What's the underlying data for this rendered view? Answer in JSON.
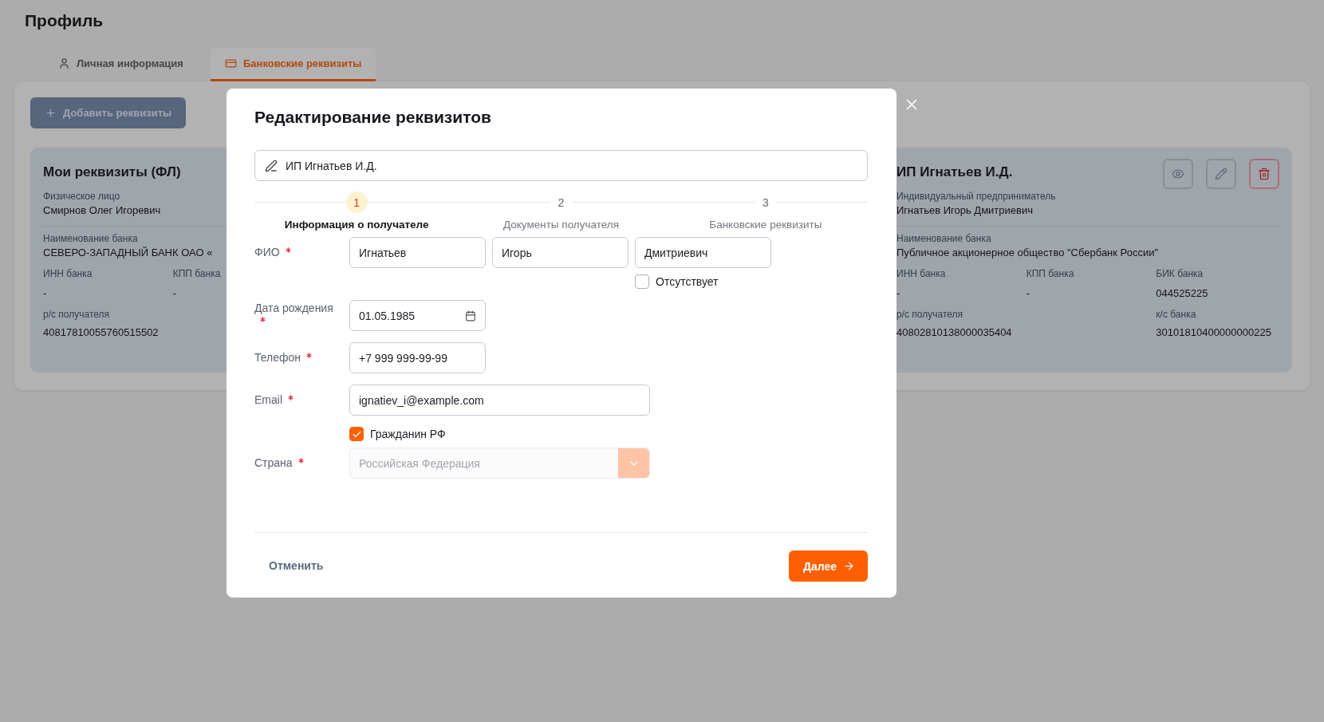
{
  "page": {
    "title": "Профиль"
  },
  "tabs": [
    {
      "label": "Личная информация",
      "selected": false
    },
    {
      "label": "Банковские реквизиты",
      "selected": true
    }
  ],
  "add_button": {
    "label": "Добавить реквизиты"
  },
  "cards": [
    {
      "kind": "partial",
      "title": "Мои реквизиты (ФЛ)",
      "type_label": "Физическое лицо",
      "holder": "Смирнов Олег Игоревич",
      "bank_label": "Наименование банка",
      "bank_name": "СЕВЕРО-ЗАПАДНЫЙ БАНК ОАО «",
      "row1": [
        {
          "label": "ИНН банка",
          "value": "-"
        },
        {
          "label": "КПП банка",
          "value": "-"
        }
      ],
      "row2": [
        {
          "label": "р/с получателя",
          "value": "40817810055760515502"
        }
      ]
    },
    {
      "kind": "full",
      "title": "ИП Игнатьев И.Д.",
      "type_label": "Индивидуальный предприниматель",
      "holder": "Игнатьев Игорь Дмитриевич",
      "bank_label": "Наименование банка",
      "bank_name": "Публичное акционерное общество \"Сбербанк России\"",
      "row1": [
        {
          "label": "ИНН банка",
          "value": "-"
        },
        {
          "label": "КПП банка",
          "value": "-"
        },
        {
          "label": "БИК банка",
          "value": "044525225"
        }
      ],
      "row2": [
        {
          "label": "р/с получателя",
          "value": "40802810138000035404"
        },
        {
          "label": "к/с банка",
          "value": "30101810400000000225"
        }
      ]
    }
  ],
  "dialog": {
    "title": "Редактирование реквизитов",
    "name_field": {
      "value": "ИП Игнатьев И.Д."
    },
    "steps": [
      {
        "number": "1",
        "label": "Информация о получателе",
        "selected": true
      },
      {
        "number": "2",
        "label": "Документы получателя",
        "selected": false
      },
      {
        "number": "3",
        "label": "Банковские реквизиты",
        "selected": false
      }
    ],
    "rows": [
      {
        "kind": "names",
        "label": "ФИО",
        "required": true,
        "values": [
          "Игнатьев",
          "Игорь",
          "Дмитриевич"
        ],
        "checkbox": {
          "label": "Отсутствует",
          "checked": false
        }
      },
      {
        "kind": "date",
        "label": "Дата рождения",
        "required": true,
        "value": "01.05.1985"
      },
      {
        "kind": "phone",
        "label": "Телефон",
        "required": true,
        "value": "+7 999 999-99-99"
      },
      {
        "kind": "email",
        "label": "Email",
        "required": true,
        "value": "ignatiev_i@example.com"
      },
      {
        "kind": "select",
        "label": "Страна",
        "required": true,
        "value": "Российская Федерация",
        "disabled": true,
        "checkbox": {
          "label": "Гражданин РФ",
          "checked": true
        }
      }
    ],
    "cancel_button": {
      "label": "Отменить"
    },
    "next_button": {
      "label": "Далее"
    }
  }
}
